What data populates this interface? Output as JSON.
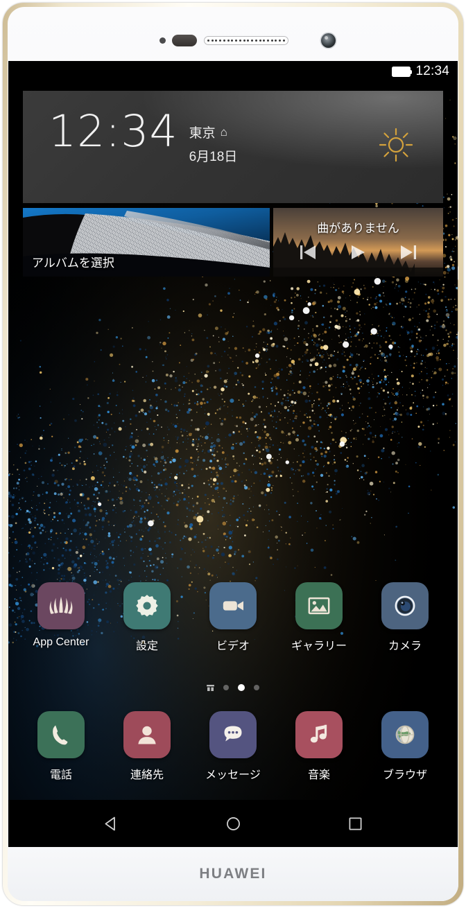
{
  "device": {
    "brand_logo": "HUAWEI",
    "frame_color": "#e4d6b2",
    "bezel_color": "#f3f4f6"
  },
  "hardware": {
    "proximity_sensor": "sensor-dot",
    "light_sensor": "sensor-pill",
    "earpiece": "earpiece-grille",
    "front_camera": "front-camera",
    "power_button": "power-button",
    "volume_button": "volume-button"
  },
  "status_bar": {
    "battery_icon": "battery-full-icon",
    "time": "12:34"
  },
  "clock_widget": {
    "time": "12:34",
    "city": "東京",
    "home_glyph": "⌂",
    "date": "6月18日",
    "weather_icon": "sun-icon",
    "weather_color": "#d9a83a"
  },
  "photo_widget": {
    "label": "アルバムを選択"
  },
  "music_widget": {
    "label": "曲がありません",
    "controls": [
      {
        "name": "previous-button",
        "glyph": "prev"
      },
      {
        "name": "play-button",
        "glyph": "play"
      },
      {
        "name": "next-button",
        "glyph": "next"
      }
    ]
  },
  "apps": {
    "row1": [
      {
        "label": "App Center",
        "icon": "huawei-flower-icon",
        "bg": "#6b4760",
        "fg": "#f0e4da"
      },
      {
        "label": "設定",
        "icon": "gear-icon",
        "bg": "#3f7a74",
        "fg": "#eef0e6"
      },
      {
        "label": "ビデオ",
        "icon": "camcorder-icon",
        "bg": "#4b6b8c",
        "fg": "#ece4d6"
      },
      {
        "label": "ギャラリー",
        "icon": "photo-icon",
        "bg": "#3c7155",
        "fg": "#ece4d6"
      },
      {
        "label": "カメラ",
        "icon": "camera-lens-icon",
        "bg": "#4d6480",
        "fg": "#2a3b53"
      }
    ],
    "row2": [
      {
        "label": "電話",
        "icon": "phone-icon",
        "bg": "#3c7158",
        "fg": "#f2ece0"
      },
      {
        "label": "連絡先",
        "icon": "contact-icon",
        "bg": "#9e4b5a",
        "fg": "#f2e3d8"
      },
      {
        "label": "メッセージ",
        "icon": "chat-bubble-icon",
        "bg": "#545480",
        "fg": "#f5f1ea"
      },
      {
        "label": "音楽",
        "icon": "music-note-icon",
        "bg": "#a8505f",
        "fg": "#f4e9e0"
      },
      {
        "label": "ブラウザ",
        "icon": "globe-icon",
        "bg": "#44618a",
        "fg": "#e9e4d6"
      }
    ]
  },
  "page_indicator": {
    "grid_icon": "home-grid-icon",
    "dots": 3,
    "active_index": 1
  },
  "nav_bar": {
    "back": "back-triangle-icon",
    "home": "home-circle-icon",
    "recents": "recents-square-icon"
  }
}
